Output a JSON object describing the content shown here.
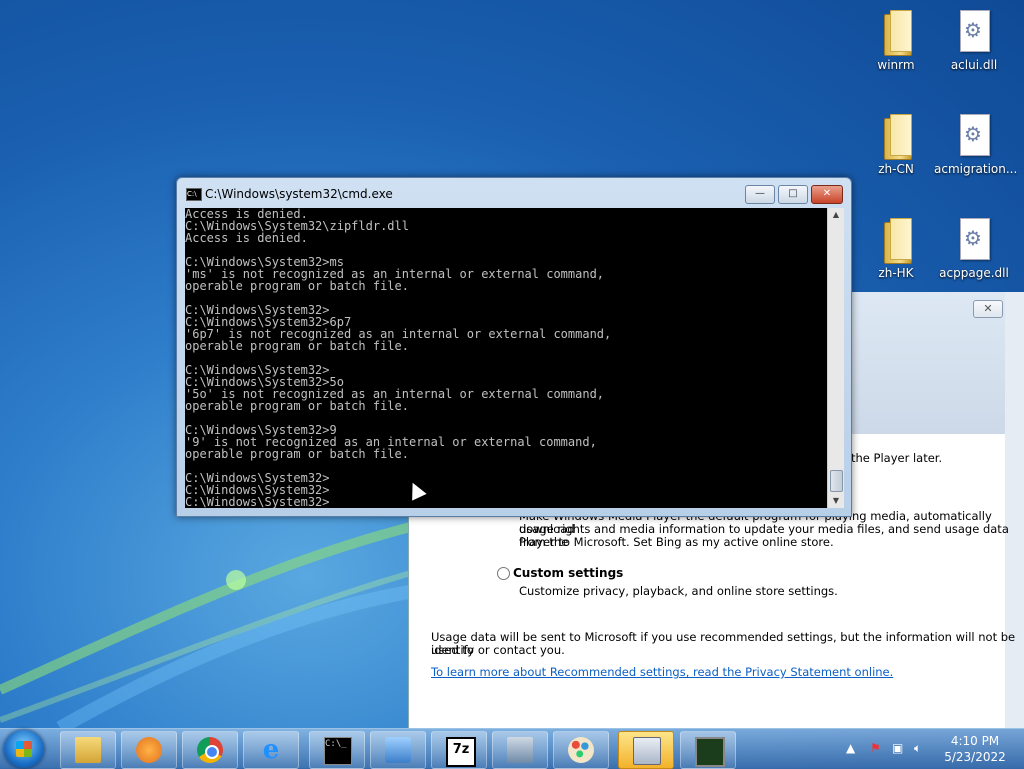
{
  "desktop_icons": [
    {
      "label": "winrm",
      "kind": "folder"
    },
    {
      "label": "aclui.dll",
      "kind": "file"
    },
    {
      "label": "zh-CN",
      "kind": "folder"
    },
    {
      "label": "acmigration...",
      "kind": "file"
    },
    {
      "label": "zh-HK",
      "kind": "folder"
    },
    {
      "label": "acppage.dll",
      "kind": "file"
    }
  ],
  "cmd": {
    "title": "C:\\Windows\\system32\\cmd.exe",
    "lines": [
      "Access is denied.",
      "C:\\Windows\\System32\\zipfldr.dll",
      "Access is denied.",
      "",
      "C:\\Windows\\System32>ms",
      "'ms' is not recognized as an internal or external command,",
      "operable program or batch file.",
      "",
      "C:\\Windows\\System32>",
      "C:\\Windows\\System32>6p7",
      "'6p7' is not recognized as an internal or external command,",
      "operable program or batch file.",
      "",
      "C:\\Windows\\System32>",
      "C:\\Windows\\System32>5o",
      "'5o' is not recognized as an internal or external command,",
      "operable program or batch file.",
      "",
      "C:\\Windows\\System32>9",
      "'9' is not recognized as an internal or external command,",
      "operable program or batch file.",
      "",
      "C:\\Windows\\System32>",
      "C:\\Windows\\System32>",
      "C:\\Windows\\System32>"
    ],
    "minimize_label": "—",
    "maximize_label": "□",
    "close_label": "✕"
  },
  "wmp_dialog": {
    "close_label": "✕",
    "player_later": "the Player later.",
    "recommended_desc_1": "Make Windows Media Player the default program for playing media, automatically download",
    "recommended_desc_2": "usage rights and media information to update your media files, and send usage data from the",
    "recommended_desc_3": "Player to Microsoft. Set Bing as my active online store.",
    "custom_label": "Custom settings",
    "custom_desc": "Customize privacy, playback, and online store settings.",
    "usage_note_1": "Usage data will be sent to Microsoft if you use recommended settings, but the information will not be used to",
    "usage_note_2": "identify or contact you.",
    "privacy_link": "To learn more about Recommended settings, read the Privacy Statement online."
  },
  "taskbar": {
    "apps": [
      "windows-explorer",
      "media-player",
      "chrome",
      "internet-explorer",
      "cmd",
      "control-panel",
      "7zip",
      "network",
      "paint",
      "calculator",
      "system-monitor"
    ],
    "active": "calculator",
    "clock_time": "4:10 PM",
    "clock_date": "5/23/2022"
  }
}
